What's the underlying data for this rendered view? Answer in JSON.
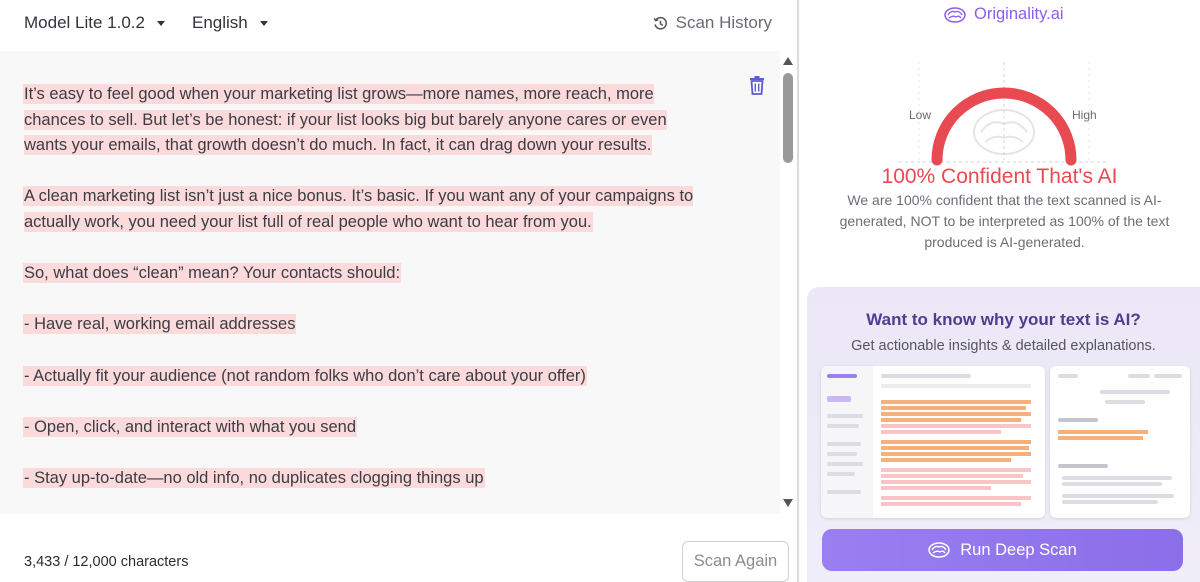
{
  "topbar": {
    "model_label": "Model Lite 1.0.2",
    "language_label": "English",
    "history_label": "Scan History"
  },
  "editor": {
    "paragraphs": [
      "It’s easy to feel good when your marketing list grows—more names, more reach, more chances to sell. But let’s be honest: if your list looks big but barely anyone cares or even wants your emails, that growth doesn’t do much. In fact, it can drag down your results.",
      "A clean marketing list isn’t just a nice bonus. It’s basic. If you want any of your campaigns to actually work, you need your list full of real people who want to hear from you.",
      "So, what does “clean” mean? Your contacts should:",
      "- Have real, working email addresses",
      "- Actually fit your audience (not random folks who don’t care about your offer)",
      "- Open, click, and interact with what you send",
      "- Stay up-to-date—no old info, no duplicates clogging things up"
    ],
    "highlight_color": "#fadada"
  },
  "footer": {
    "char_count": "3,433 / 12,000 characters",
    "scan_again_label": "Scan Again"
  },
  "result": {
    "brand_name": "Originality.ai",
    "gauge_low": "Low",
    "gauge_high": "High",
    "gauge_value": 1.0,
    "confidence_title": "100% Confident That's AI",
    "confidence_desc": "We are 100% confident that the text scanned is AI-generated, NOT to be interpreted as 100% of the text produced is AI-generated.",
    "accent_color": "#e84a52",
    "brand_color": "#8d5ef0"
  },
  "promo": {
    "title": "Want to know why your text is AI?",
    "subtitle": "Get actionable insights & detailed explanations.",
    "button_label": "Run Deep Scan"
  }
}
